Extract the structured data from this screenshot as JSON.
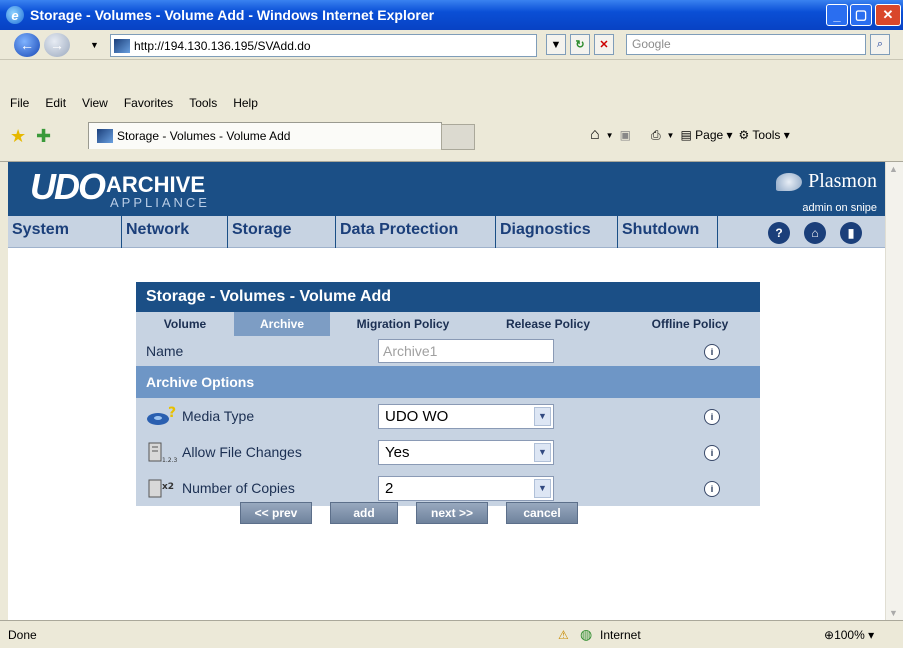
{
  "window": {
    "title": "Storage - Volumes - Volume Add - Windows Internet Explorer"
  },
  "address": {
    "url": "http://194.130.136.195/SVAdd.do",
    "search_placeholder": "Google"
  },
  "menu": [
    "File",
    "Edit",
    "View",
    "Favorites",
    "Tools",
    "Help"
  ],
  "tab": {
    "title": "Storage - Volumes - Volume Add"
  },
  "toolbar": {
    "page": "Page",
    "tools": "Tools"
  },
  "brand": {
    "logo_udo": "UDO",
    "logo_archive": "ARCHIVE",
    "logo_appliance": "APPLIANCE",
    "vendor": "Plasmon",
    "user": "admin on snipe"
  },
  "nav": [
    "System",
    "Network",
    "Storage",
    "Data Protection",
    "Diagnostics",
    "Shutdown"
  ],
  "panel": {
    "title": "Storage - Volumes - Volume Add",
    "tabs": [
      "Volume",
      "Archive",
      "Migration Policy",
      "Release Policy",
      "Offline Policy"
    ],
    "active_tab": "Archive",
    "name_label": "Name",
    "name_placeholder": "Archive1",
    "section": "Archive Options",
    "fields": [
      {
        "label": "Media Type",
        "value": "UDO WO"
      },
      {
        "label": "Allow File Changes",
        "value": "Yes"
      },
      {
        "label": "Number of Copies",
        "value": "2"
      }
    ],
    "buttons": [
      "<< prev",
      "add",
      "next >>",
      "cancel"
    ]
  },
  "status": {
    "text": "Done",
    "zone": "Internet",
    "zoom": "100%"
  }
}
